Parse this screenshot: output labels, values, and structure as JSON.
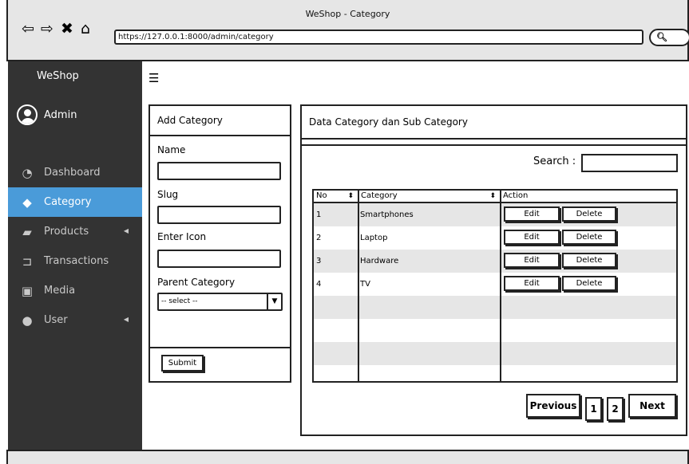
{
  "window": {
    "title": "WeShop - Category"
  },
  "browser": {
    "url": "https://127.0.0.1:8000/admin/category",
    "icons": [
      "back-icon",
      "forward-icon",
      "close-icon",
      "home-icon",
      "search-icon"
    ]
  },
  "sidebar": {
    "brand": "WeShop",
    "user": "Admin",
    "items": [
      {
        "label": "Dashboard",
        "icon": "dashboard-icon",
        "active": false,
        "caret": false
      },
      {
        "label": "Category",
        "icon": "tag-icon",
        "active": true,
        "caret": false
      },
      {
        "label": "Products",
        "icon": "truck-icon",
        "active": false,
        "caret": true
      },
      {
        "label": "Transactions",
        "icon": "cart-icon",
        "active": false,
        "caret": false
      },
      {
        "label": "Media",
        "icon": "image-icon",
        "active": false,
        "caret": false
      },
      {
        "label": "User",
        "icon": "user-icon",
        "active": false,
        "caret": true
      }
    ],
    "active_color": "#4a9bd9",
    "background": "#333333"
  },
  "add_form": {
    "title": "Add Category",
    "name_label": "Name",
    "slug_label": "Slug",
    "icon_label": "Enter Icon",
    "parent_label": "Parent Category",
    "parent_value": "-- select --",
    "submit_label": "Submit"
  },
  "data_panel": {
    "title": "Data Category dan Sub Category",
    "search_label": "Search :",
    "columns": [
      "No",
      "Category",
      "Action"
    ],
    "rows": [
      {
        "no": "1",
        "category": "Smartphones"
      },
      {
        "no": "2",
        "category": "Laptop"
      },
      {
        "no": "3",
        "category": "Hardware"
      },
      {
        "no": "4",
        "category": "TV"
      }
    ],
    "edit_label": "Edit",
    "delete_label": "Delete",
    "pagination": {
      "previous": "Previous",
      "pages": [
        "1",
        "2"
      ],
      "next": "Next"
    }
  }
}
